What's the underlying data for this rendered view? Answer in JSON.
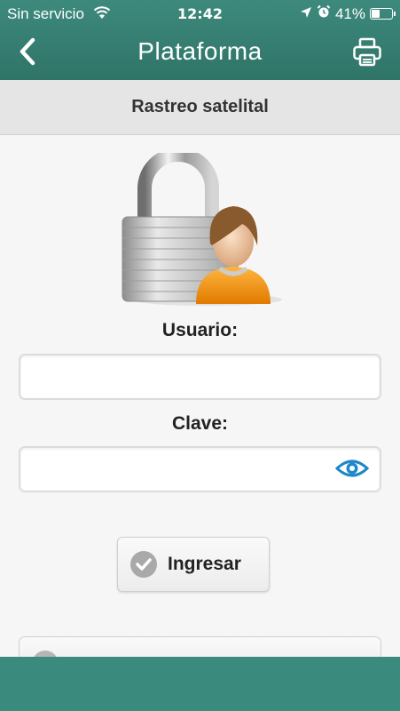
{
  "status_bar": {
    "carrier": "Sin servicio",
    "time": "12:42",
    "battery_percent": "41%",
    "battery_level": 0.41
  },
  "header": {
    "title": "Plataforma",
    "back_icon": "chevron-left-icon",
    "print_icon": "printer-icon"
  },
  "subheader": {
    "title": "Rastreo satelital"
  },
  "form": {
    "user_label": "Usuario:",
    "user_value": "",
    "password_label": "Clave:",
    "password_value": "",
    "show_password_icon": "eye-icon",
    "login_button": "Ingresar"
  },
  "colors": {
    "header": "#2f7467",
    "footer": "#3a8a7d",
    "eye_icon": "#1e88c8"
  }
}
